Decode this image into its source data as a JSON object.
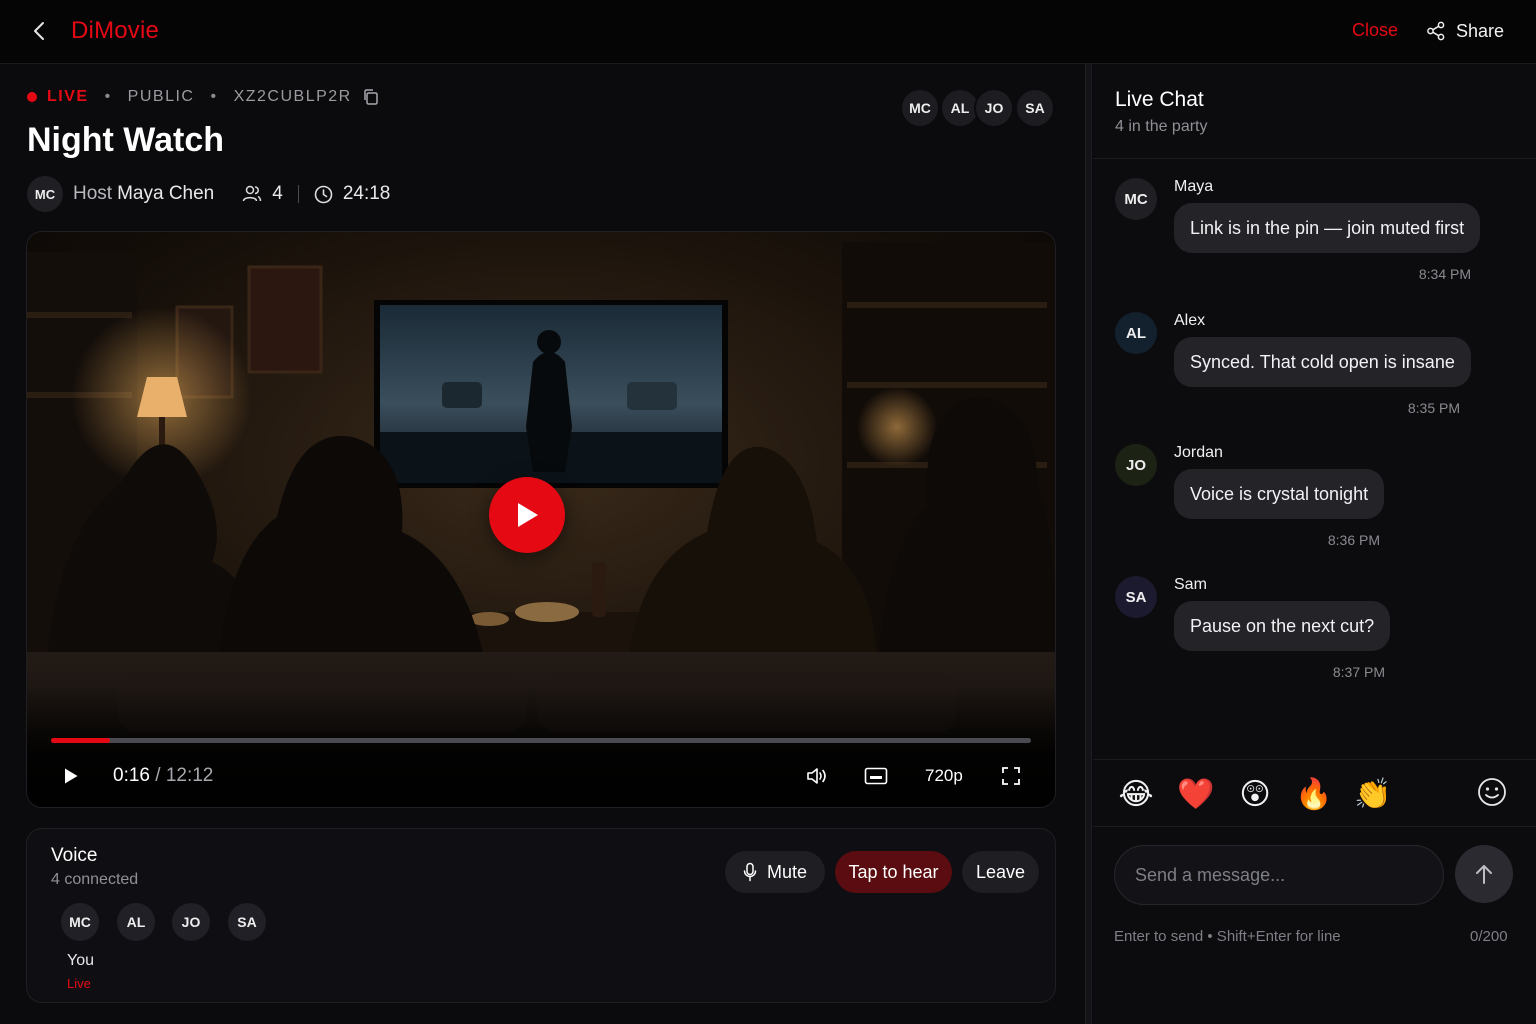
{
  "app": {
    "brand": "DiMovie",
    "close_label": "Close",
    "share_label": "Share",
    "accent": "#e50914"
  },
  "room": {
    "status": "LIVE",
    "visibility": "PUBLIC",
    "code": "XZ2CUBLP2R",
    "title": "Night Watch",
    "host_initials": "MC",
    "host_label": "Host",
    "host_name": "Maya Chen",
    "viewers": "4",
    "elapsed": "24:18",
    "party": [
      "MC",
      "AL",
      "JO",
      "SA"
    ]
  },
  "player": {
    "current": "0:16",
    "sep": "/",
    "duration": "12:12",
    "quality": "720p",
    "progress_fraction": 0.06,
    "icons": [
      "play-icon",
      "volume-icon",
      "subtitles-icon",
      "fullscreen-icon"
    ]
  },
  "voice": {
    "title": "Voice",
    "subtitle": "4 connected",
    "members": [
      "MC",
      "AL",
      "JO",
      "SA"
    ],
    "self_label": "You",
    "self_status": "Live",
    "mute_label": "Mute",
    "hear_label": "Tap to hear",
    "leave_label": "Leave"
  },
  "chat": {
    "title": "Live Chat",
    "subtitle": "4 in the party",
    "messages": [
      {
        "initials": "MC",
        "name": "Maya",
        "text": "Link is in the pin — join muted first",
        "time": "8:34 PM",
        "avatar_color": "#1f1f24"
      },
      {
        "initials": "AL",
        "name": "Alex",
        "text": "Synced. That cold open is insane",
        "time": "8:35 PM",
        "avatar_color": "#13202e"
      },
      {
        "initials": "JO",
        "name": "Jordan",
        "text": "Voice is crystal tonight",
        "time": "8:36 PM",
        "avatar_color": "#1c2214"
      },
      {
        "initials": "SA",
        "name": "Sam",
        "text": "Pause on the next cut?",
        "time": "8:37 PM",
        "avatar_color": "#1c1a2e"
      }
    ],
    "reactions": [
      "😂",
      "❤️",
      "😲",
      "🔥",
      "👏"
    ],
    "input_placeholder": "Send a message...",
    "hint": "Enter to send • Shift+Enter for line",
    "counter": "0/200"
  }
}
